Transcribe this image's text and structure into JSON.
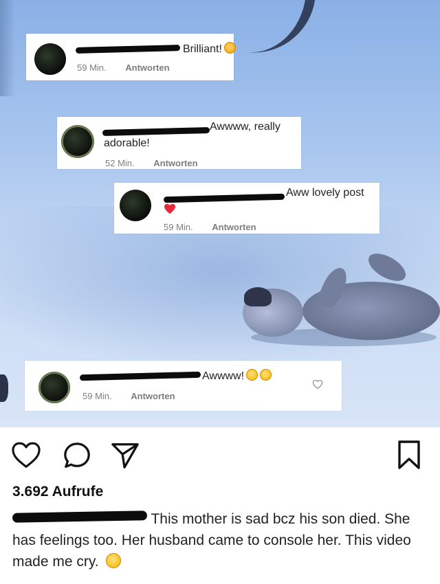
{
  "comments": [
    {
      "text": "Brilliant!",
      "time": "59 Min.",
      "reply": "Antworten"
    },
    {
      "text": "Awwww, really",
      "text_line2": "adorable!",
      "time": "52 Min.",
      "reply": "Antworten"
    },
    {
      "text": "Aww lovely post",
      "time": "59 Min.",
      "reply": "Antworten"
    },
    {
      "text": "Awwww!",
      "time": "59 Min.",
      "reply": "Antworten"
    }
  ],
  "post": {
    "views": "3.692 Aufrufe",
    "caption": "This mother is sad bcz his son died. She has feelings too. Her husband came to console her. This video made me cry."
  },
  "icons": {
    "like": "heart-outline-icon",
    "comment": "comment-bubble-icon",
    "share": "paper-plane-icon",
    "save": "bookmark-icon"
  },
  "colors": {
    "heart_red": "#e8283c",
    "meta_gray": "#7d7d7d",
    "video_blue": "#a9c6ee"
  }
}
